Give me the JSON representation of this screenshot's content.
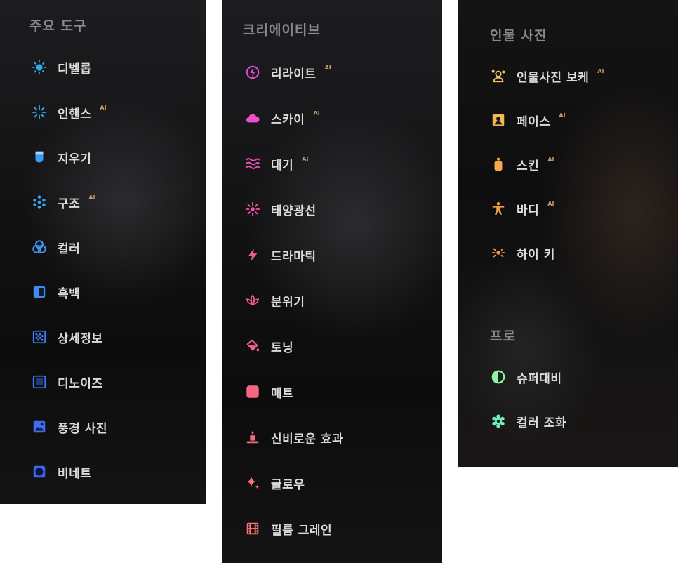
{
  "main": {
    "heading": "주요 도구",
    "items": [
      {
        "label": "디벨롭",
        "ai": ""
      },
      {
        "label": "인핸스",
        "ai": "AI"
      },
      {
        "label": "지우기",
        "ai": ""
      },
      {
        "label": "구조",
        "ai": "AI"
      },
      {
        "label": "컬러",
        "ai": ""
      },
      {
        "label": "흑백",
        "ai": ""
      },
      {
        "label": "상세정보",
        "ai": ""
      },
      {
        "label": "디노이즈",
        "ai": ""
      },
      {
        "label": "풍경 사진",
        "ai": ""
      },
      {
        "label": "비네트",
        "ai": ""
      }
    ]
  },
  "creative": {
    "heading": "크리에이티브",
    "items": [
      {
        "label": "리라이트",
        "ai": "AI"
      },
      {
        "label": "스카이",
        "ai": "AI"
      },
      {
        "label": "대기",
        "ai": "AI"
      },
      {
        "label": "태양광선",
        "ai": ""
      },
      {
        "label": "드라마틱",
        "ai": ""
      },
      {
        "label": "분위기",
        "ai": ""
      },
      {
        "label": "토닝",
        "ai": ""
      },
      {
        "label": "매트",
        "ai": ""
      },
      {
        "label": "신비로운 효과",
        "ai": ""
      },
      {
        "label": "글로우",
        "ai": ""
      },
      {
        "label": "필름 그레인",
        "ai": ""
      }
    ]
  },
  "portrait": {
    "heading": "인물 사진",
    "items": [
      {
        "label": "인물사진 보케",
        "ai": "AI"
      },
      {
        "label": "페이스",
        "ai": "AI"
      },
      {
        "label": "스킨",
        "ai": "AI"
      },
      {
        "label": "바디",
        "ai": "AI"
      },
      {
        "label": "하이 키",
        "ai": ""
      }
    ]
  },
  "pro": {
    "heading": "프로",
    "items": [
      {
        "label": "슈퍼대비",
        "ai": ""
      },
      {
        "label": "컬러 조화",
        "ai": ""
      }
    ]
  },
  "icons": {
    "main": [
      "sun-icon",
      "sparkle-burst-icon",
      "eraser-icon",
      "dots-grid-icon",
      "color-circles-icon",
      "half-square-icon",
      "checker-square-icon",
      "noise-square-icon",
      "landscape-image-icon",
      "vignette-square-icon"
    ],
    "creative": [
      "bolt-circle-icon",
      "cloud-icon",
      "waves-icon",
      "sunrays-icon",
      "lightning-icon",
      "lotus-icon",
      "paint-bucket-icon",
      "rounded-square-icon",
      "candle-icon",
      "sparkle-star-icon",
      "film-strip-icon"
    ],
    "portrait": [
      "person-blur-icon",
      "face-portrait-icon",
      "skin-bottle-icon",
      "body-figure-icon",
      "high-key-icon"
    ],
    "pro": [
      "contrast-circle-icon",
      "gear-flower-icon"
    ]
  },
  "colors": {
    "main_accent": [
      "#2aaef0",
      "#26b0ee",
      "#3a9df2",
      "#3ca3f0",
      "#3f96f2",
      "#3d8cf4",
      "#3f7ff4",
      "#3f74f2",
      "#3e6cf2",
      "#3d64f1"
    ],
    "creative_accent": [
      "#e84ad9",
      "#ec4fc9",
      "#ef52ba",
      "#f255a8",
      "#f35a99",
      "#f35c8e",
      "#f5608a",
      "#f66683",
      "#f76c7c",
      "#f87276",
      "#f9786f"
    ],
    "portrait_accent": [
      "#f5c15f",
      "#f2b854",
      "#f2aa4b",
      "#f39b45",
      "#f1903f"
    ],
    "pro_accent": [
      "#8ff5a1",
      "#6df0bd"
    ]
  }
}
